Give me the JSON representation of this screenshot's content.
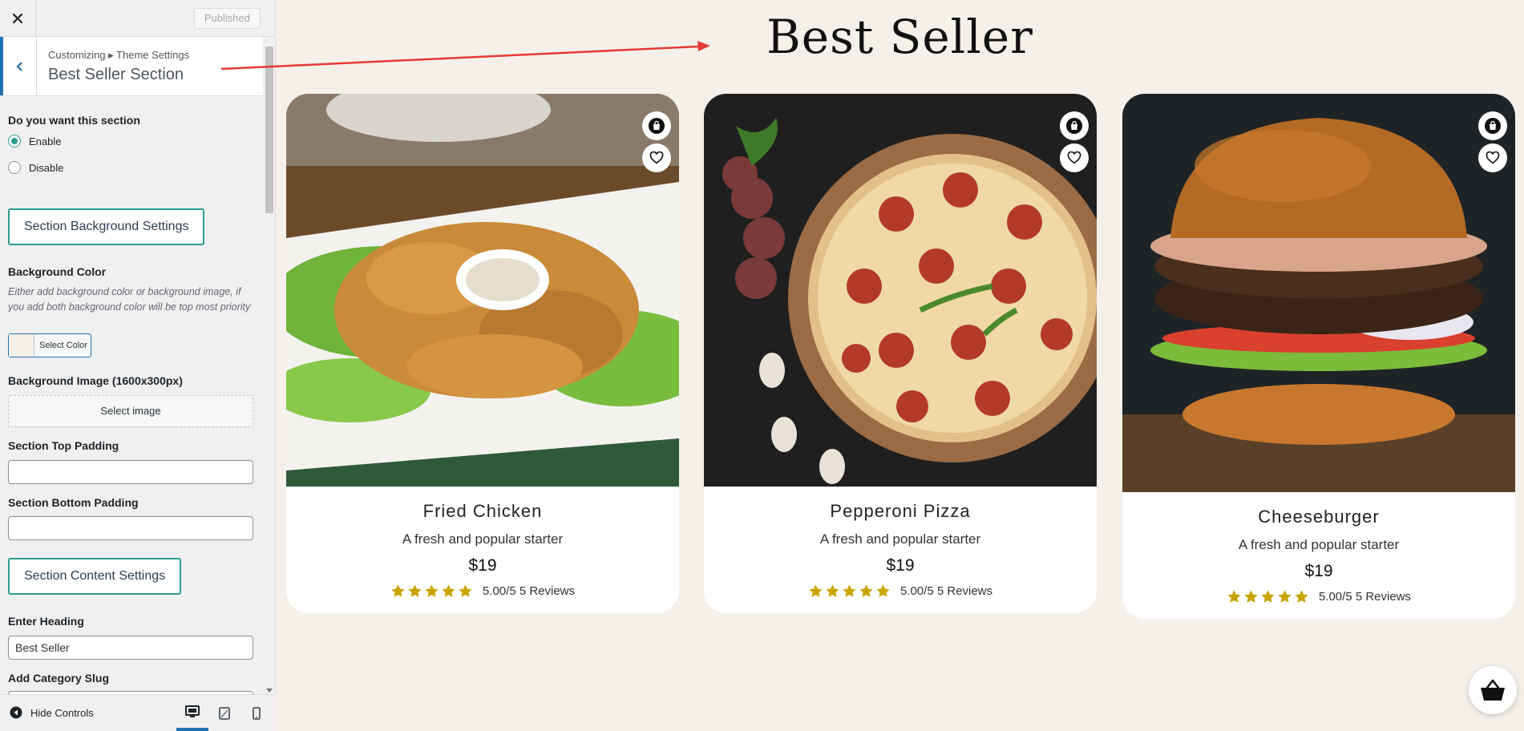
{
  "sidebar": {
    "published_label": "Published",
    "breadcrumb": "Customizing ▸ Theme Settings",
    "title": "Best Seller Section",
    "section_toggle": {
      "label": "Do you want this section",
      "options": [
        "Enable",
        "Disable"
      ],
      "selected": "Enable"
    },
    "bg_settings_button": "Section Background Settings",
    "bg_color": {
      "label": "Background Color",
      "description": "Either add background color or background image, if you add both background color will be top most priority",
      "button_label": "Select Color",
      "swatch": "#f5f1ea"
    },
    "bg_image": {
      "label": "Background Image (1600x300px)",
      "button_label": "Select image"
    },
    "top_padding": {
      "label": "Section Top Padding",
      "value": ""
    },
    "bottom_padding": {
      "label": "Section Bottom Padding",
      "value": ""
    },
    "content_settings_button": "Section Content Settings",
    "heading_field": {
      "label": "Enter Heading",
      "value": "Best Seller"
    },
    "category_field": {
      "label": "Add Category Slug",
      "value": ""
    },
    "footer": {
      "hide_controls": "Hide Controls",
      "devices": [
        "desktop-icon",
        "tablet-icon",
        "mobile-icon"
      ]
    }
  },
  "preview": {
    "heading": "Best Seller",
    "products": [
      {
        "name": "Fried Chicken",
        "desc": "A fresh and popular starter",
        "price": "$19",
        "rating": "5.00/5 5 Reviews",
        "stars": 5
      },
      {
        "name": "Pepperoni Pizza",
        "desc": "A fresh and popular starter",
        "price": "$19",
        "rating": "5.00/5 5 Reviews",
        "stars": 5
      },
      {
        "name": "Cheeseburger",
        "desc": "A fresh and popular starter",
        "price": "$19",
        "rating": "5.00/5 5 Reviews",
        "stars": 5
      }
    ]
  },
  "colors": {
    "accent_teal": "#2a9d8f",
    "wp_blue": "#2271b1",
    "star_gold": "#c9a400",
    "annotation_arrow": "#e53935",
    "page_bg": "#f5f1ea"
  }
}
